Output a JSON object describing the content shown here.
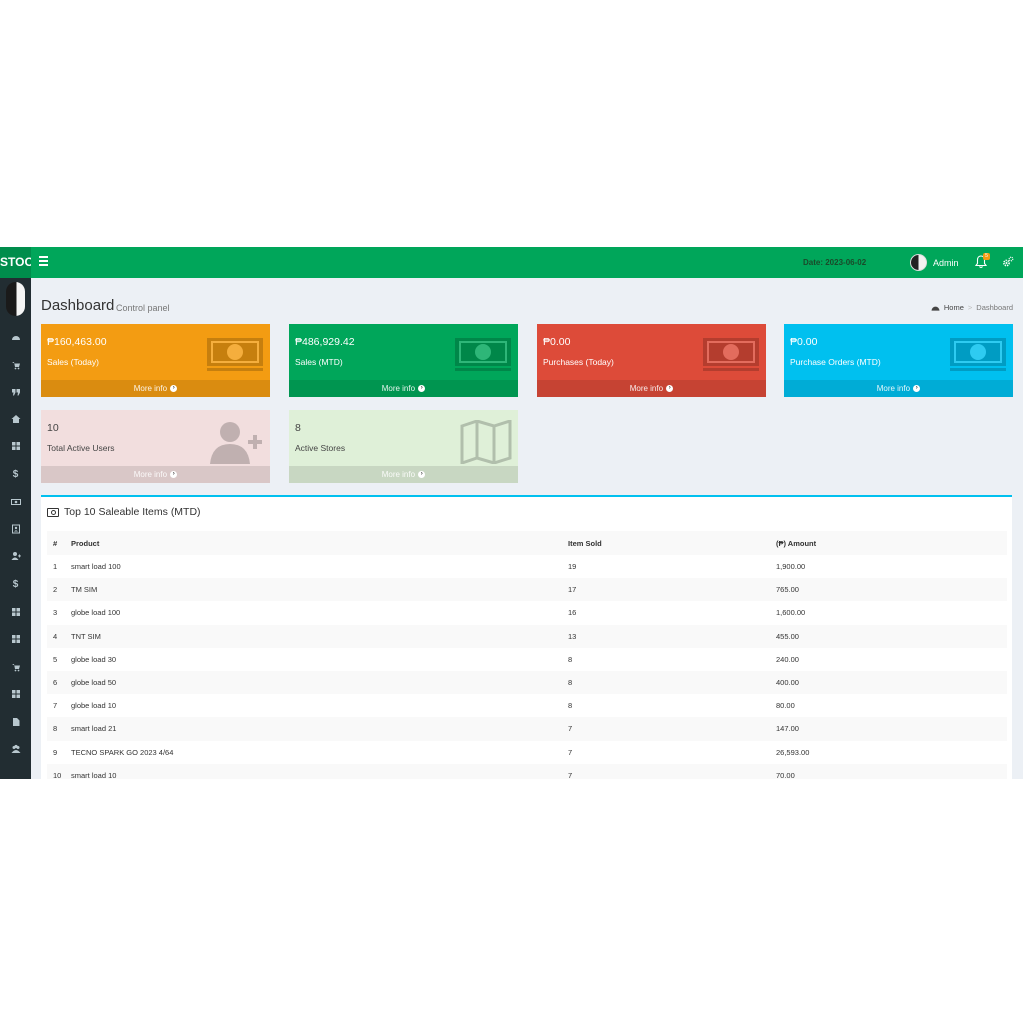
{
  "header": {
    "logo": "STOC",
    "date": "Date: 2023-06-02",
    "user": "Admin",
    "notif_count": "5",
    "colors": {
      "header": "#00a65a",
      "sidebar": "#222d32"
    }
  },
  "sidebar": {
    "icons": [
      "dashboard-icon",
      "cart-icon",
      "quote-icon",
      "home-icon",
      "barcode-icon",
      "dollar-icon",
      "money-icon",
      "id-card-icon",
      "user-plus-icon",
      "dollar-icon",
      "barcode-icon",
      "barcode-icon",
      "cart-icon",
      "barcode-icon",
      "file-icon",
      "users-icon"
    ]
  },
  "page": {
    "title": "Dashboard",
    "subtitle": "Control panel",
    "breadcrumb": {
      "home": "Home",
      "current": "Dashboard"
    }
  },
  "boxes": [
    {
      "value": "₱160,463.00",
      "label": "Sales (Today)",
      "more": "More info",
      "color": "#f39c12",
      "icon": "money-icon"
    },
    {
      "value": "₱486,929.42",
      "label": "Sales (MTD)",
      "more": "More info",
      "color": "#00a65a",
      "icon": "money-icon"
    },
    {
      "value": "₱0.00",
      "label": "Purchases (Today)",
      "more": "More info",
      "color": "#dd4b39",
      "icon": "money-icon"
    },
    {
      "value": "₱0.00",
      "label": "Purchase Orders (MTD)",
      "more": "More info",
      "color": "#00c0ef",
      "icon": "money-icon"
    },
    {
      "value": "10",
      "label": "Total Active Users",
      "more": "More info",
      "color": "#f2dede",
      "icon": "user-plus-icon"
    },
    {
      "value": "8",
      "label": "Active Stores",
      "more": "More info",
      "color": "#dff0d8",
      "icon": "map-icon"
    }
  ],
  "top_items": {
    "title": "Top 10 Saleable Items (MTD)",
    "columns": [
      "#",
      "Product",
      "Item Sold",
      "(₱) Amount"
    ],
    "rows": [
      [
        "1",
        "smart load 100",
        "19",
        "1,900.00"
      ],
      [
        "2",
        "TM SIM",
        "17",
        "765.00"
      ],
      [
        "3",
        "globe load 100",
        "16",
        "1,600.00"
      ],
      [
        "4",
        "TNT SIM",
        "13",
        "455.00"
      ],
      [
        "5",
        "globe load 30",
        "8",
        "240.00"
      ],
      [
        "6",
        "globe load 50",
        "8",
        "400.00"
      ],
      [
        "7",
        "globe load 10",
        "8",
        "80.00"
      ],
      [
        "8",
        "smart load 21",
        "7",
        "147.00"
      ],
      [
        "9",
        "TECNO SPARK GO 2023 4/64",
        "7",
        "26,593.00"
      ],
      [
        "10",
        "smart load 10",
        "7",
        "70.00"
      ]
    ]
  }
}
